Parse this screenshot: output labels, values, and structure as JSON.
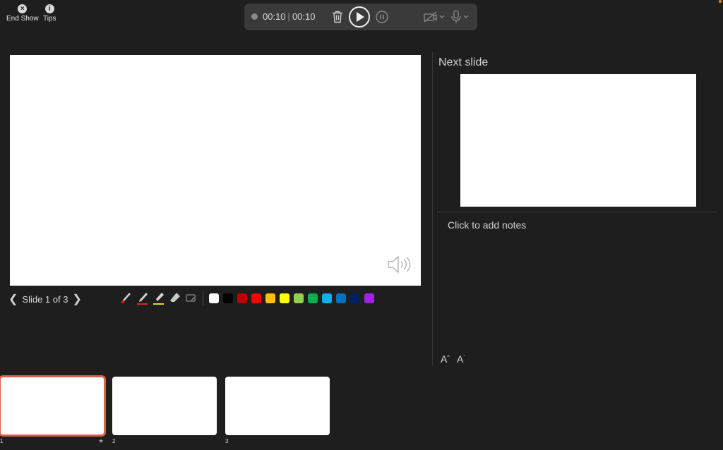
{
  "toolbar": {
    "end_show": {
      "icon": "close-icon",
      "label": "End Show"
    },
    "tips": {
      "icon": "info-icon",
      "label": "Tips"
    }
  },
  "recording": {
    "elapsed": "00:10",
    "total": "00:10",
    "separator": "|"
  },
  "navigation": {
    "prev_glyph": "❮",
    "next_glyph": "❯",
    "label": "Slide 1 of 3"
  },
  "pen_colors": [
    "#ffffff",
    "#000000",
    "#c00000",
    "#ff0000",
    "#ffc000",
    "#ffff00",
    "#92d050",
    "#00b050",
    "#00b0f0",
    "#0070c0",
    "#002060",
    "#a020f0"
  ],
  "next_slide": {
    "title": "Next slide"
  },
  "notes": {
    "placeholder": "Click to add notes"
  },
  "font_controls": {
    "increase": "A",
    "decrease": "A"
  },
  "thumbnails": [
    {
      "number": "1",
      "selected": true
    },
    {
      "number": "2",
      "selected": false
    },
    {
      "number": "3",
      "selected": false
    }
  ],
  "colors": {
    "accent": "#d9614b",
    "background": "#1e1e1e",
    "bar": "#3a3a3a"
  }
}
